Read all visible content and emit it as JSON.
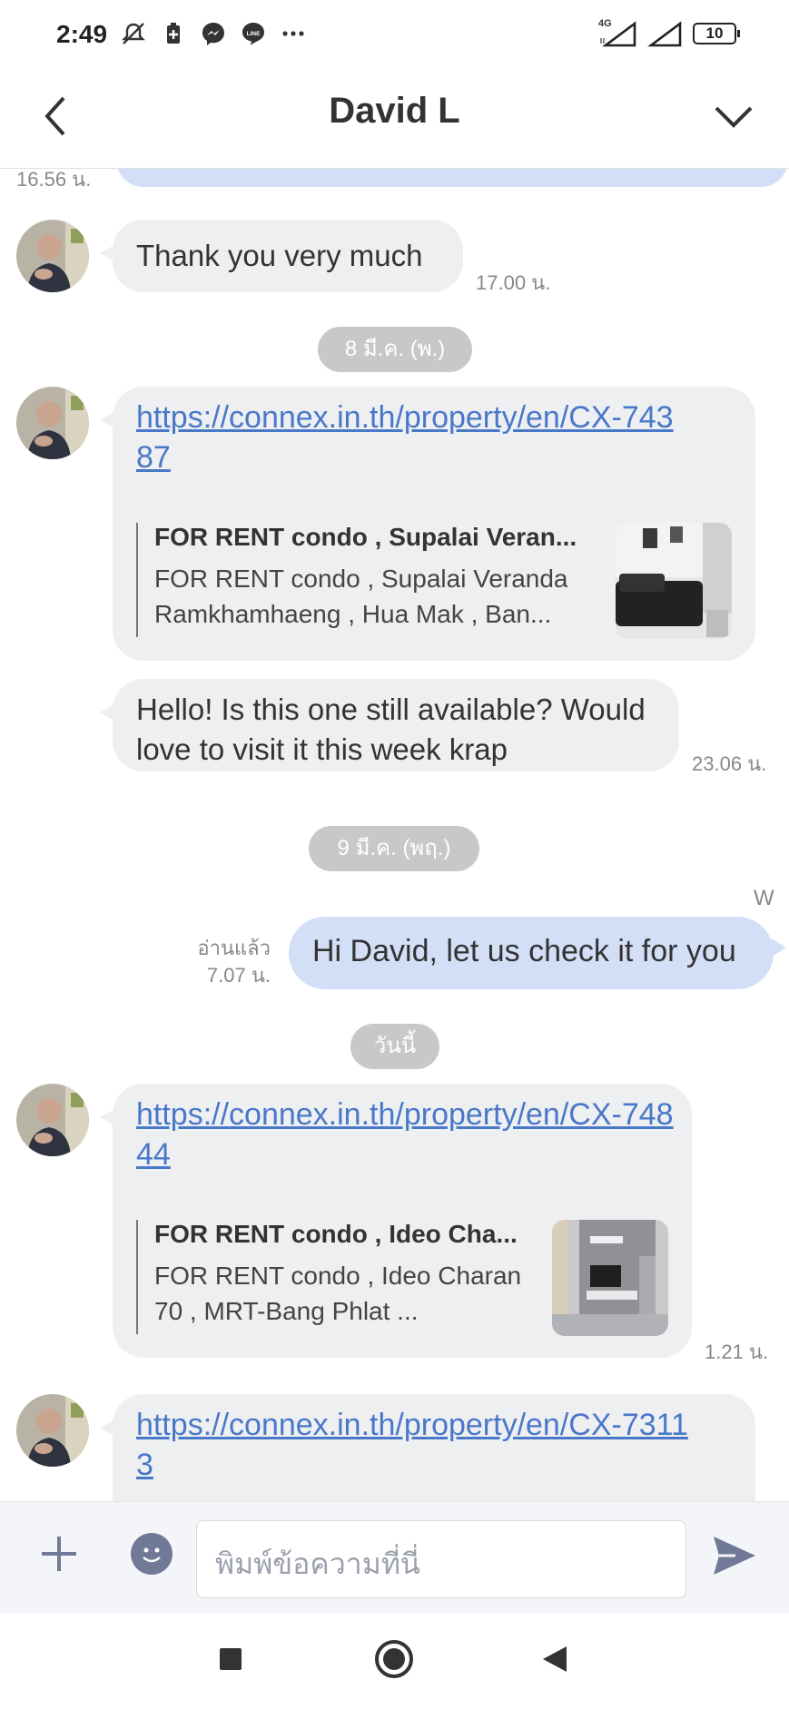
{
  "status_bar": {
    "time": "2:49",
    "network": "4G",
    "battery": "10"
  },
  "header": {
    "title": "David L"
  },
  "messages": {
    "prev_time": "16.56 น.",
    "thanks_text": "Thank you very much",
    "thanks_time": "17.00 น.",
    "date1": "8 มี.ค. (พ.)",
    "link1": "https://connex.in.th/property/en/CX-74387",
    "preview1_title": "FOR RENT condo , Supalai Veran...",
    "preview1_desc": "FOR RENT condo , Supalai Veranda Ramkhamhaeng , Hua Mak , Ban...",
    "hello_text": "Hello! Is this one still available? Would love to visit it this week krap",
    "hello_time": "23.06 น.",
    "date2": "9 มี.ค. (พฤ.)",
    "sender_initial": "W",
    "reply_text": "Hi David, let us check it for you",
    "read_label": "อ่านแล้ว",
    "reply_time": "7.07 น.",
    "date3": "วันนี้",
    "link2": "https://connex.in.th/property/en/CX-74844",
    "preview2_title": "FOR RENT condo , Ideo Cha...",
    "preview2_desc": "FOR RENT condo , Ideo Charan 70 , MRT-Bang Phlat ...",
    "link2_time": "1.21 น.",
    "link3": "https://connex.in.th/property/en/CX-73113"
  },
  "input": {
    "placeholder": "พิมพ์ข้อความที่นี่"
  },
  "colors": {
    "incoming_bubble": "#eeeff1",
    "outgoing_bubble": "#d3dff7",
    "link": "#4a78c9",
    "date_pill": "#c8c8c8",
    "icon_dark": "#707a96"
  },
  "icons": [
    "mute-icon",
    "battery-saver-icon",
    "messenger-icon",
    "line-icon",
    "more-icon",
    "signal-icon",
    "back-icon",
    "chevron-down-icon",
    "plus-icon",
    "emoji-icon",
    "send-icon",
    "nav-recents-icon",
    "nav-home-icon",
    "nav-back-icon"
  ]
}
